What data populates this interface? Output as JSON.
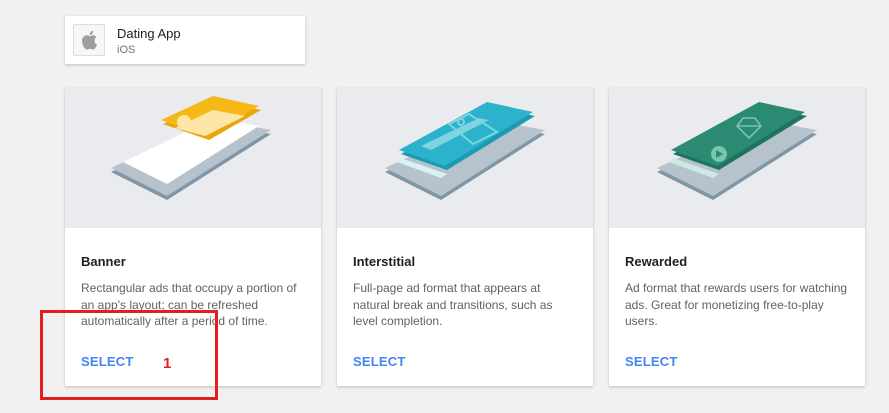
{
  "app": {
    "name": "Dating App",
    "platform": "iOS",
    "icon": "apple-icon"
  },
  "formats": [
    {
      "title": "Banner",
      "description": "Rectangular ads that occupy a portion of an app's layout; can be refreshed automatically after a period of time.",
      "select_label": "SELECT",
      "illustration": "banner-phone-illustration",
      "accent": "#f6b817"
    },
    {
      "title": "Interstitial",
      "description": "Full-page ad format that appears at natural break and transitions, such as level completion.",
      "select_label": "SELECT",
      "illustration": "interstitial-phone-illustration",
      "accent": "#2bb3cc"
    },
    {
      "title": "Rewarded",
      "description": "Ad format that rewards users for watching ads. Great for monetizing free-to-play users.",
      "select_label": "SELECT",
      "illustration": "rewarded-phone-illustration",
      "accent": "#2a8a72"
    }
  ],
  "annotation": {
    "label": "1",
    "color": "#e02020"
  }
}
